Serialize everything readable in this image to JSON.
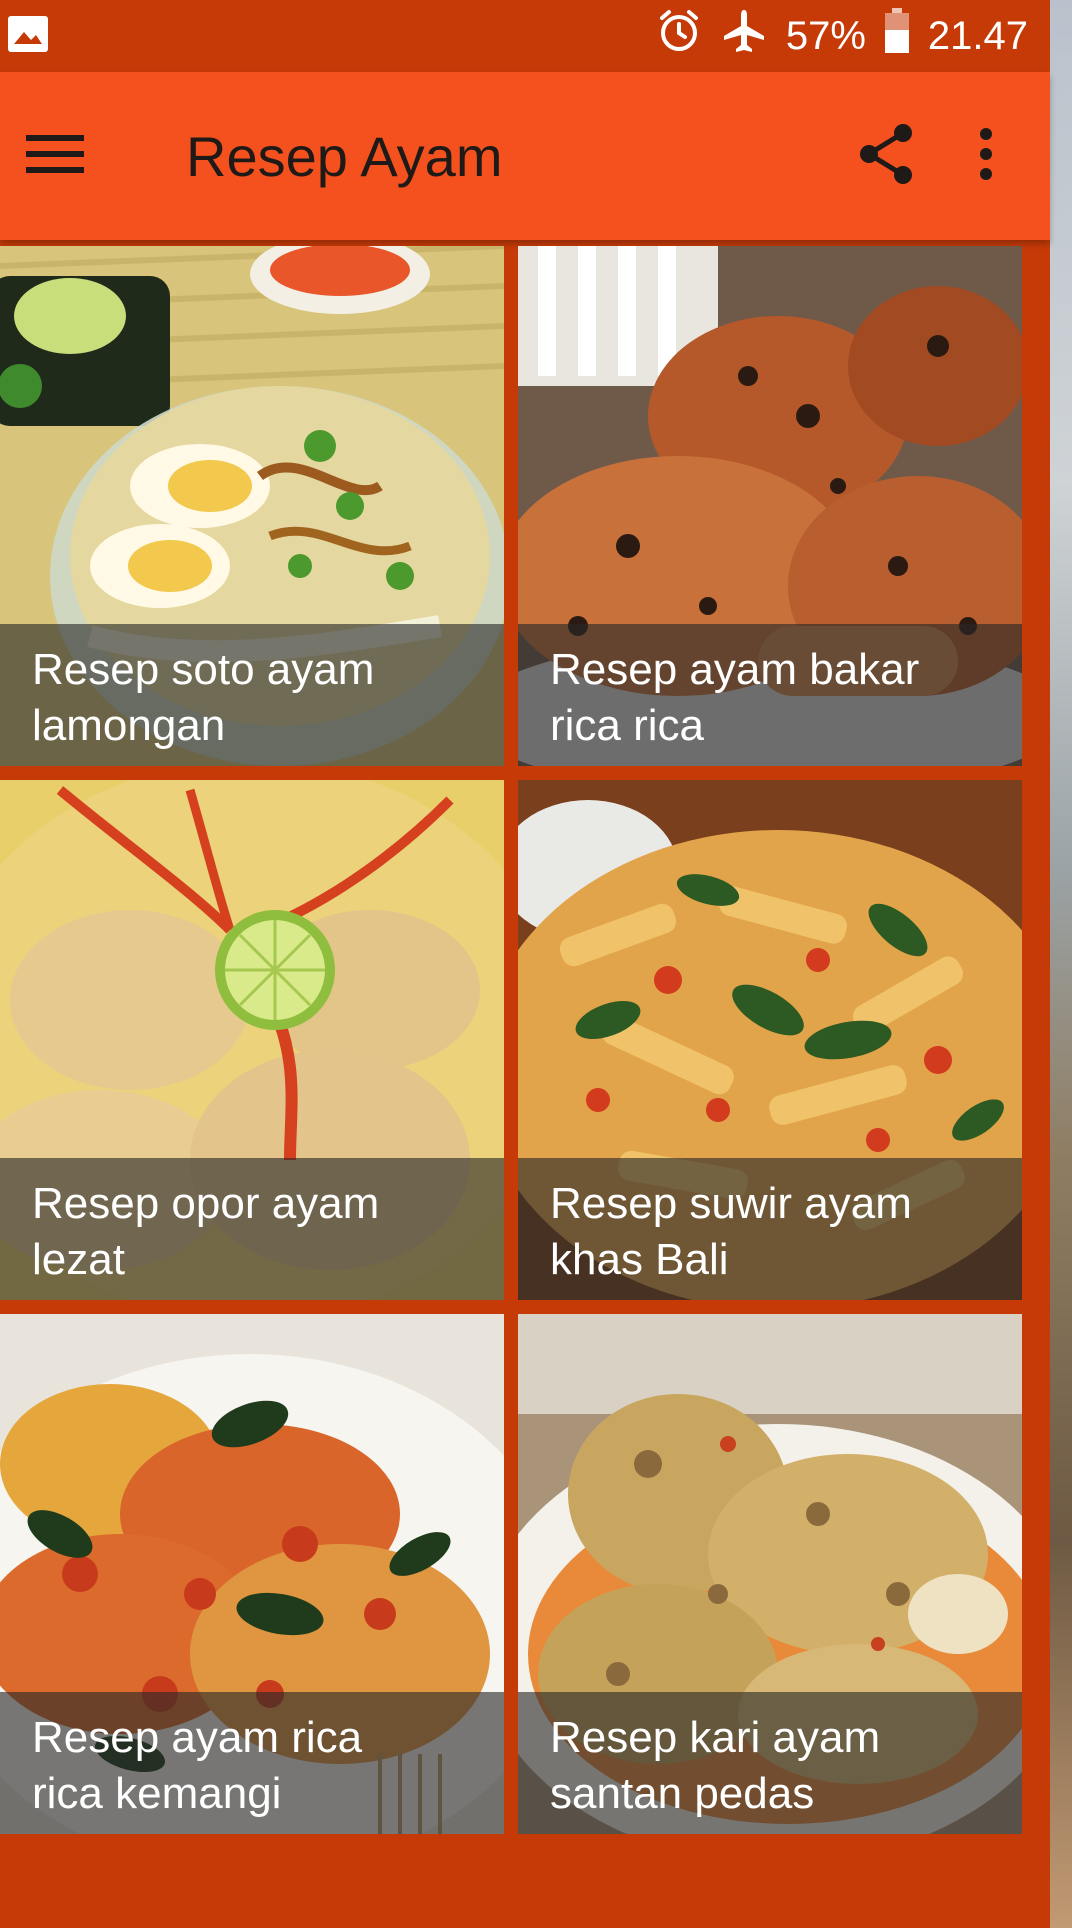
{
  "status_bar": {
    "left_icon": "image-icon",
    "icons": [
      "alarm-icon",
      "airplane-icon",
      "battery-icon"
    ],
    "battery": "57%",
    "time": "21.47"
  },
  "app_bar": {
    "title": "Resep Ayam",
    "menu_icon": "hamburger-menu-icon",
    "share_icon": "share-icon",
    "more_icon": "more-vertical-icon"
  },
  "colors": {
    "status_bar": "#c63a08",
    "app_bar": "#f4511e",
    "title_text": "#1f1a17",
    "caption_overlay": "rgba(40,40,40,0.62)"
  },
  "recipes": [
    {
      "title_line1": "Resep soto ayam",
      "title_line2": "lamongan"
    },
    {
      "title_line1": "Resep ayam bakar",
      "title_line2": "rica rica"
    },
    {
      "title_line1": "Resep opor ayam",
      "title_line2": "lezat"
    },
    {
      "title_line1": "Resep suwir ayam",
      "title_line2": "khas Bali"
    },
    {
      "title_line1": "Resep ayam rica",
      "title_line2": "rica kemangi"
    },
    {
      "title_line1": "Resep kari ayam",
      "title_line2": "santan pedas"
    }
  ]
}
